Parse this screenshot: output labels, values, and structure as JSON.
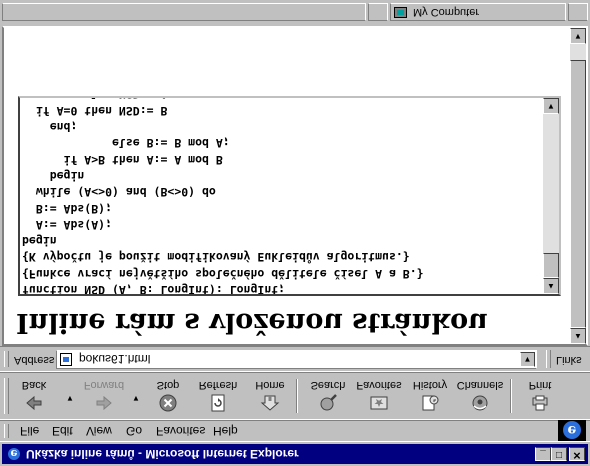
{
  "window": {
    "title": "Ukázka inline rámů - Microsoft Internet Explorer",
    "buttons": {
      "minimize": "_",
      "maximize": "□",
      "close": "✕"
    }
  },
  "menu": {
    "items": [
      {
        "label": "File"
      },
      {
        "label": "Edit"
      },
      {
        "label": "View"
      },
      {
        "label": "Go"
      },
      {
        "label": "Favorites"
      },
      {
        "label": "Help"
      }
    ]
  },
  "toolbar": {
    "buttons": [
      {
        "label": "Back",
        "icon": "back-arrow-icon"
      },
      {
        "label": "Forward",
        "icon": "forward-arrow-icon"
      },
      {
        "label": "Stop",
        "icon": "stop-icon"
      },
      {
        "label": "Refresh",
        "icon": "refresh-icon"
      },
      {
        "label": "Home",
        "icon": "home-icon"
      },
      {
        "label": "Search",
        "icon": "search-globe-icon"
      },
      {
        "label": "Favorites",
        "icon": "favorites-icon"
      },
      {
        "label": "History",
        "icon": "history-icon"
      },
      {
        "label": "Channels",
        "icon": "channels-icon"
      },
      {
        "label": "Print",
        "icon": "print-icon"
      }
    ]
  },
  "address": {
    "label": "Address",
    "value": "pokus61.html",
    "links_label": "Links"
  },
  "page": {
    "heading": "Inline rám s vloženou stránkou",
    "code_lines": [
      "function NSD (A, B: LongInt): LongInt;",
      "{Funkce vrací největšího společného dělitele čísel A a B.}",
      "{K výpočtu je použit modifikovaný Eukleidův algoritmus.}",
      "begin",
      "  A:= Abs(A);",
      "  B:= Abs(B);",
      "  while (A<>0) and (B<>0) do",
      "    begin",
      "      if A>B then A:= A mod B",
      "             else B:= B mod A;",
      "    end;",
      "  if A=0 then NSD:= B",
      "         else NSD:= A;"
    ]
  },
  "status": {
    "zone_text": "My Computer"
  },
  "colors": {
    "title_bar": "#000080",
    "chrome": "#c0c0c0",
    "page_bg": "#ffffff"
  }
}
